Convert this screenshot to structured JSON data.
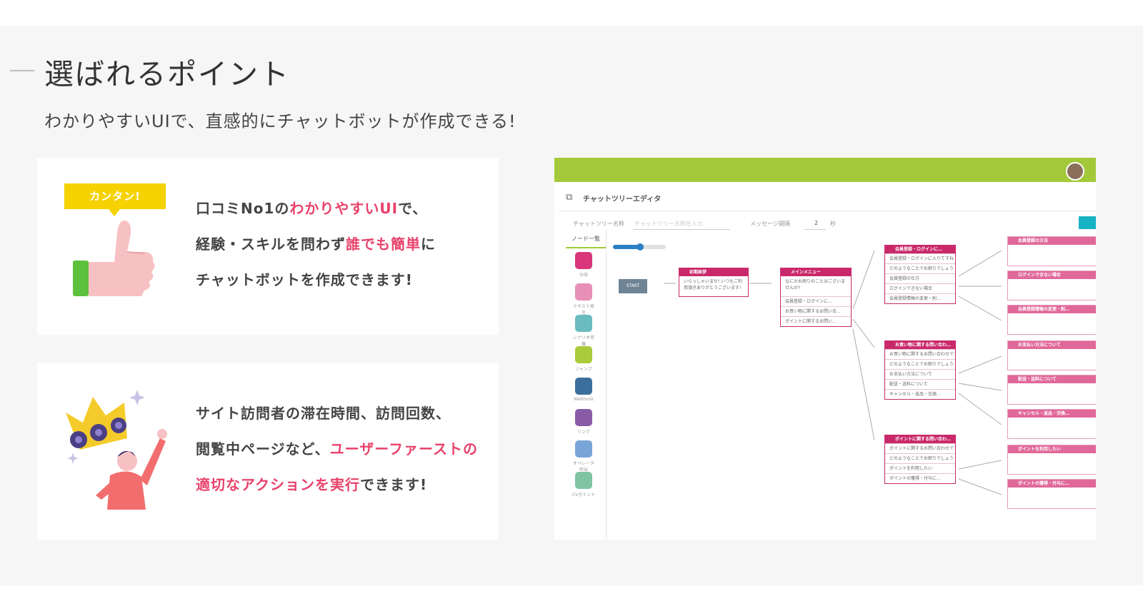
{
  "section": {
    "title": "選ばれるポイント",
    "subtitle": "わかりやすいUIで、直感的にチャットボットが作成できる!"
  },
  "card1": {
    "badge": "カンタン!",
    "line1": {
      "a": "口コミNo1の",
      "b": "わかりやすいUI",
      "c": "で、"
    },
    "line2": {
      "a": "経験・スキルを問わず",
      "b": "誰でも簡単",
      "c": "に"
    },
    "line3": "チャットボットを作成できます!"
  },
  "card2": {
    "line1": "サイト訪問者の滞在時間、訪問回数、",
    "line2": {
      "a": "閲覧中ページなど、",
      "b": "ユーザーファーストの"
    },
    "line3": {
      "a": "適切なアクションを実行",
      "b": "できます!"
    }
  },
  "editor": {
    "title": "チャットツリーエディタ",
    "field_name_label": "チャットツリー名称",
    "field_name_placeholder": "チャットツリー名称を入力",
    "field_interval_label": "メッセージ間隔",
    "field_interval_value": "2",
    "field_interval_unit": "秒",
    "sidebar_title": "ノード一覧",
    "sidebar_items": [
      {
        "label": "分岐",
        "color": "#d8357a"
      },
      {
        "label": "テキスト発言",
        "color": "#e78fb6"
      },
      {
        "label": "シナリオ待機",
        "color": "#6bbcc0"
      },
      {
        "label": "ジャンプ",
        "color": "#a9cc3b"
      },
      {
        "label": "Webhook",
        "color": "#3d6f9c"
      },
      {
        "label": "リンク",
        "color": "#8a5ba6"
      },
      {
        "label": "オペレータ呼出",
        "color": "#7aa5d8"
      },
      {
        "label": "CVポイント",
        "color": "#7fc4a3"
      }
    ],
    "start_label": "START",
    "node_greeting": {
      "title": "初期挨拶",
      "rows": [
        "いらっしゃいませ! いつもご利用頂きありがとうございます!"
      ]
    },
    "node_menu": {
      "title": "メインメニュー",
      "rows": [
        "なにかお困りのことはございませんか?",
        "会員登録・ログインに…",
        "お買い物に関するお問い合…",
        "ポイントに関するお問い…"
      ]
    },
    "node_member": {
      "title": "会員登録・ログインに…",
      "rows": [
        "会員登録・ログインに入りてすね",
        "どのようなことでお困りでしょう",
        "会員登録の仕方",
        "ログインできない場合",
        "会員登録情報の変更・削…"
      ]
    },
    "node_shop": {
      "title": "お買い物に関する問い合わ…",
      "rows": [
        "お買い物に関するお問い合わせですね",
        "どのようなことでお困りでしょう…",
        "お支払い方法について",
        "配送・送料について",
        "キャンセル・返品・交換…"
      ]
    },
    "node_point": {
      "title": "ポイントに関する問い合わ…",
      "rows": [
        "ポイントに関するお問い合わせですね",
        "どのようなことでお困りでしょう",
        "ポイントを利用したい",
        "ポイントの獲得・付与に…"
      ]
    },
    "leaf_nodes": [
      "会員登録の方法",
      "ログインできない場合",
      "会員登録情報の変更・削…",
      "お支払い方法について",
      "配送・送料について",
      "キャンセル・返品・交換…",
      "ポイントを利用したい",
      "ポイントの獲得・付与に…"
    ]
  }
}
